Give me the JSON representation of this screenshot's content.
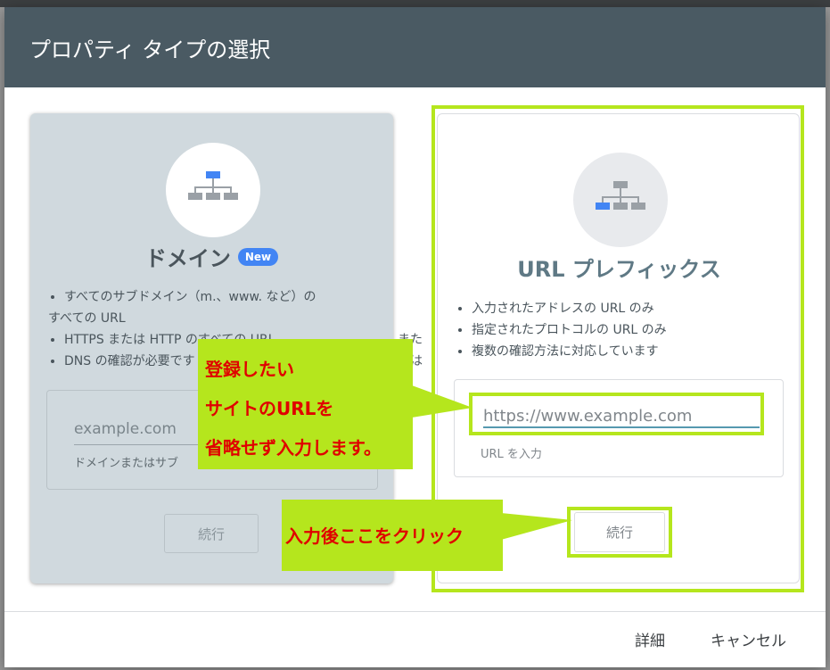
{
  "dialog": {
    "title": "プロパティ タイプの選択"
  },
  "domain_card": {
    "title": "ドメイン",
    "badge": "New",
    "bullets": [
      "すべてのサブドメイン（m.、www. など）の",
      "すべての URL",
      "HTTPS または HTTP のすべての URL",
      "DNS の確認が必要です"
    ],
    "input_value": "example.com",
    "input_hint": "ドメインまたはサブ",
    "continue_label": "続行",
    "icon": "sitemap-icon",
    "stray_text_1": "また",
    "stray_text_2": "は"
  },
  "url_card": {
    "title": "URL プレフィックス",
    "bullets": [
      "入力されたアドレスの URL のみ",
      "指定されたプロトコルの URL のみ",
      "複数の確認方法に対応しています"
    ],
    "input_placeholder": "https://www.example.com",
    "input_hint": "URL を入力",
    "continue_label": "続行",
    "icon": "sitemap-icon"
  },
  "annotations": {
    "callout1": [
      "登録したい",
      "サイトのURLを",
      "省略せず入力します。"
    ],
    "callout2": "入力後ここをクリック",
    "highlight_color": "#b5e61d",
    "text_color": "#e00000"
  },
  "footer": {
    "details_label": "詳細",
    "cancel_label": "キャンセル"
  },
  "colors": {
    "header_bg": "#4a5a63",
    "accent_blue": "#4285f4"
  }
}
